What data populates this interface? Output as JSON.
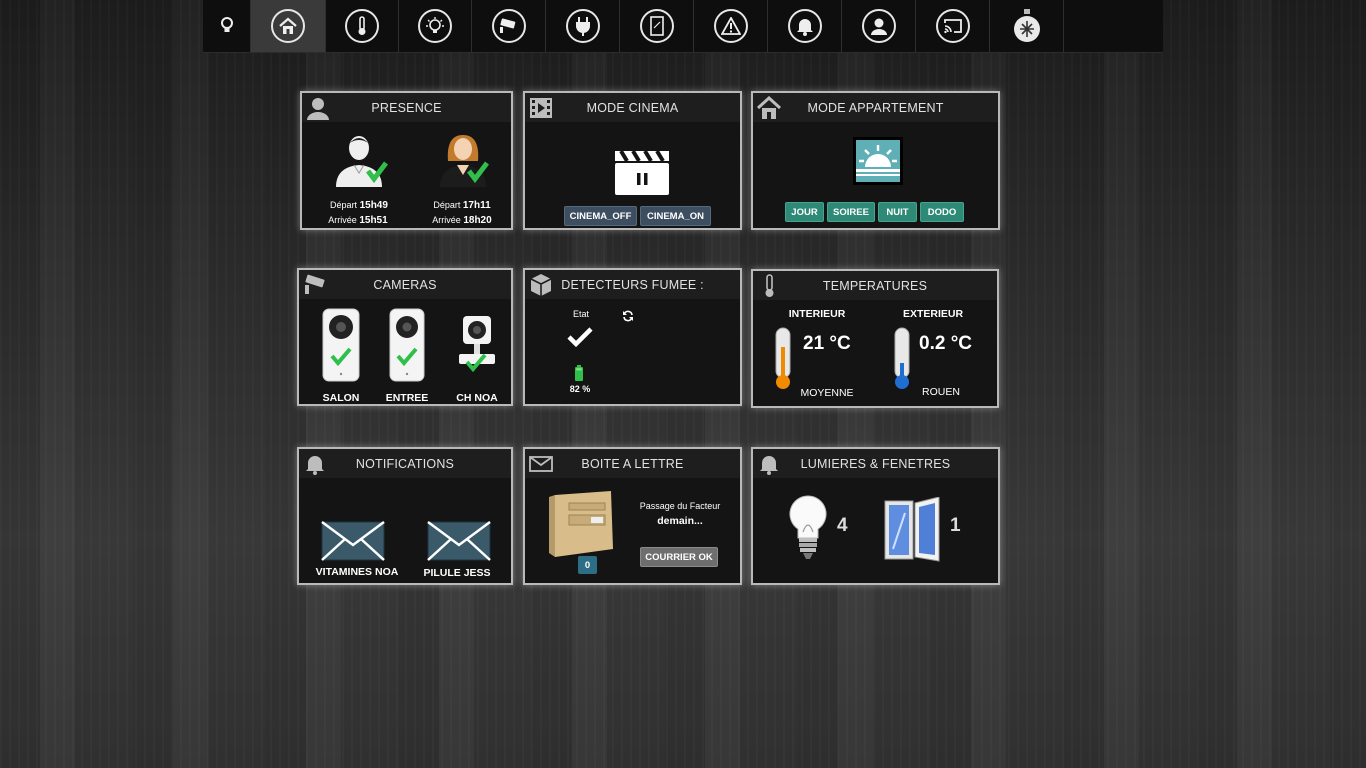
{
  "topnav": {
    "items": [
      {
        "icon": "bulb-icon"
      },
      {
        "icon": "home-icon"
      },
      {
        "icon": "thermometer-icon"
      },
      {
        "icon": "lightbulb-icon"
      },
      {
        "icon": "camera-icon"
      },
      {
        "icon": "plug-icon"
      },
      {
        "icon": "window-icon"
      },
      {
        "icon": "warning-icon"
      },
      {
        "icon": "bell-icon"
      },
      {
        "icon": "user-icon"
      },
      {
        "icon": "cast-icon"
      },
      {
        "icon": "christmas-ornament-icon"
      }
    ],
    "active_index": 1
  },
  "presence": {
    "title": "PRESENCE",
    "persons": [
      {
        "depart_label": "Départ",
        "depart": "15h49",
        "arrivee_label": "Arrivée",
        "arrivee": "15h51"
      },
      {
        "depart_label": "Départ",
        "depart": "17h11",
        "arrivee_label": "Arrivée",
        "arrivee": "18h20"
      }
    ]
  },
  "cinema": {
    "title": "MODE CINEMA",
    "buttons": [
      "CINEMA_OFF",
      "CINEMA_ON"
    ]
  },
  "appartement": {
    "title": "MODE APPARTEMENT",
    "buttons": [
      "JOUR",
      "SOIREE",
      "NUIT",
      "DODO"
    ]
  },
  "cameras": {
    "title": "CAMERAS",
    "items": [
      "SALON",
      "ENTREE",
      "CH NOA"
    ]
  },
  "fumee": {
    "title": "DETECTEURS FUMEE :",
    "etat_label": "Etat",
    "battery": "82 %"
  },
  "temperatures": {
    "title": "TEMPERATURES",
    "interieur": {
      "label": "INTERIEUR",
      "value": "21 °C",
      "name": "MOYENNE"
    },
    "exterieur": {
      "label": "EXTERIEUR",
      "value": "0.2 °C",
      "name": "ROUEN"
    }
  },
  "notifications": {
    "title": "NOTIFICATIONS",
    "items": [
      "VITAMINES NOA",
      "PILULE JESS"
    ]
  },
  "boite": {
    "title": "BOITE A LETTRE",
    "count": "0",
    "passage_label": "Passage du Facteur",
    "passage_value": "demain...",
    "button": "COURRIER OK"
  },
  "lumieres": {
    "title": "LUMIERES & FENETRES",
    "lights": "4",
    "windows": "1"
  },
  "colors": {
    "teal": "#2e8a76",
    "slate": "#3d4e60",
    "check_green": "#2fbf4a"
  }
}
